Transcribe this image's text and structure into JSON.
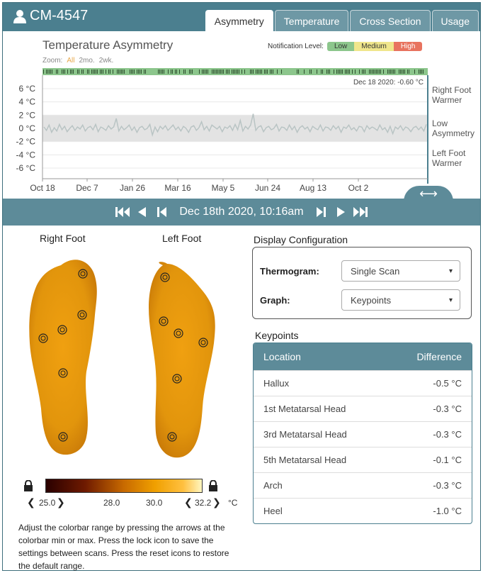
{
  "header": {
    "patient_id": "CM-4547",
    "tabs": [
      {
        "label": "Asymmetry",
        "active": true
      },
      {
        "label": "Temperature",
        "active": false
      },
      {
        "label": "Cross Section",
        "active": false
      },
      {
        "label": "Usage",
        "active": false
      }
    ]
  },
  "chart": {
    "title": "Temperature Asymmetry",
    "notification_label": "Notification Level:",
    "levels": [
      "Low",
      "Medium",
      "High"
    ],
    "zoom_label": "Zoom:",
    "zoom_options": [
      "All",
      "2mo.",
      "2wk."
    ],
    "zoom_active": "All",
    "marker_label": "Dec 18 2020: -0.60 °C",
    "side_labels": {
      "right": [
        "Right Foot",
        "Warmer"
      ],
      "low": [
        "Low",
        "Asymmetry"
      ],
      "left": [
        "Left Foot",
        "Warmer"
      ]
    }
  },
  "chart_data": {
    "type": "line",
    "title": "Temperature Asymmetry",
    "yticks": [
      "6 °C",
      "4 °C",
      "2 °C",
      "0 °C",
      "-2 °C",
      "-4 °C",
      "-6 °C"
    ],
    "xticks": [
      "Oct 18",
      "Dec 7",
      "Jan 26",
      "Mar 16",
      "May 5",
      "Jun 24",
      "Aug 13",
      "Oct 2"
    ],
    "ylim": [
      -7,
      7
    ],
    "low_asymmetry_band": [
      -2,
      2
    ],
    "series": [
      {
        "values": [
          0.2,
          -0.3,
          0.5,
          -0.6,
          0.1,
          -0.4,
          0.6,
          -0.2,
          0.3,
          -0.5,
          0.0,
          0.4,
          -0.3,
          0.2,
          -0.1,
          0.5,
          -0.4,
          0.1,
          0.3,
          -0.2,
          0.6,
          -0.5,
          0.2,
          0.0,
          -0.3,
          0.4,
          -0.1,
          0.2,
          1.5,
          -0.4,
          0.3,
          -0.2,
          0.1,
          0.5,
          -0.3,
          0.2,
          -0.6,
          0.1,
          0.3,
          -0.2,
          0.0,
          0.6,
          -1.0,
          0.2,
          -0.5,
          0.3,
          -0.1,
          0.4,
          -0.3,
          0.1,
          0.5,
          -0.2,
          0.2,
          -0.4,
          0.3,
          0.0,
          -0.6,
          0.2,
          0.4,
          -0.3,
          0.1,
          1.0,
          -0.2,
          0.3,
          -0.4,
          0.5,
          0.2,
          -0.1,
          0.3,
          -0.5,
          0.2,
          0.0,
          0.4,
          -0.3,
          0.6,
          -0.2,
          1.2,
          -0.4,
          0.3,
          -0.1,
          0.5,
          2.2,
          -0.3,
          0.2,
          0.4,
          -0.5,
          0.1,
          0.3,
          -0.2,
          0.0,
          0.6,
          -0.4,
          0.2,
          0.1,
          -0.3,
          0.5,
          -0.2,
          0.3,
          -0.6,
          0.1,
          0.4,
          -0.1,
          0.2,
          -0.5,
          0.3,
          0.0,
          -0.2,
          0.5,
          -0.4,
          0.2,
          0.1,
          -0.3,
          0.4,
          -0.1,
          0.3,
          -0.6,
          0.2,
          0.0,
          0.5,
          -0.2,
          0.1,
          -0.4,
          0.3,
          0.2,
          -0.5,
          0.4,
          -0.1,
          0.2,
          0.0,
          -0.3,
          0.5,
          -0.2,
          0.1,
          -0.6,
          0.3,
          -0.8,
          0.2,
          -0.1,
          0.4,
          -0.3,
          0.2,
          0.0,
          -0.5,
          0.1,
          0.3,
          -0.2,
          0.2,
          -0.4,
          0.6
        ]
      }
    ],
    "grid": true
  },
  "navigation": {
    "date": "Dec 18th 2020, 10:16am"
  },
  "feet": {
    "right_label": "Right Foot",
    "left_label": "Left Foot"
  },
  "colorbar": {
    "min": "25.0",
    "max": "32.2",
    "ticks": [
      "28.0",
      "30.0"
    ],
    "unit": "°C"
  },
  "help_text": "Adjust the colorbar range by pressing the arrows at the colorbar min or max. Press the lock icon to save the settings between scans. Press the reset icons to restore the default range.",
  "display_config": {
    "title": "Display Configuration",
    "thermogram_label": "Thermogram:",
    "thermogram_value": "Single Scan",
    "graph_label": "Graph:",
    "graph_value": "Keypoints"
  },
  "keypoints": {
    "title": "Keypoints",
    "columns": [
      "Location",
      "Difference"
    ],
    "rows": [
      {
        "location": "Hallux",
        "difference": "-0.5 °C"
      },
      {
        "location": "1st Metatarsal Head",
        "difference": "-0.3 °C"
      },
      {
        "location": "3rd Metatarsal Head",
        "difference": "-0.3 °C"
      },
      {
        "location": "5th Metatarsal Head",
        "difference": "-0.1 °C"
      },
      {
        "location": "Arch",
        "difference": "-0.3 °C"
      },
      {
        "location": "Heel",
        "difference": "-1.0 °C"
      }
    ]
  },
  "colors": {
    "header": "#4b7f8f",
    "nav": "#5d8b99",
    "foot": "#e69a0e",
    "series": "#b9c4c4"
  }
}
